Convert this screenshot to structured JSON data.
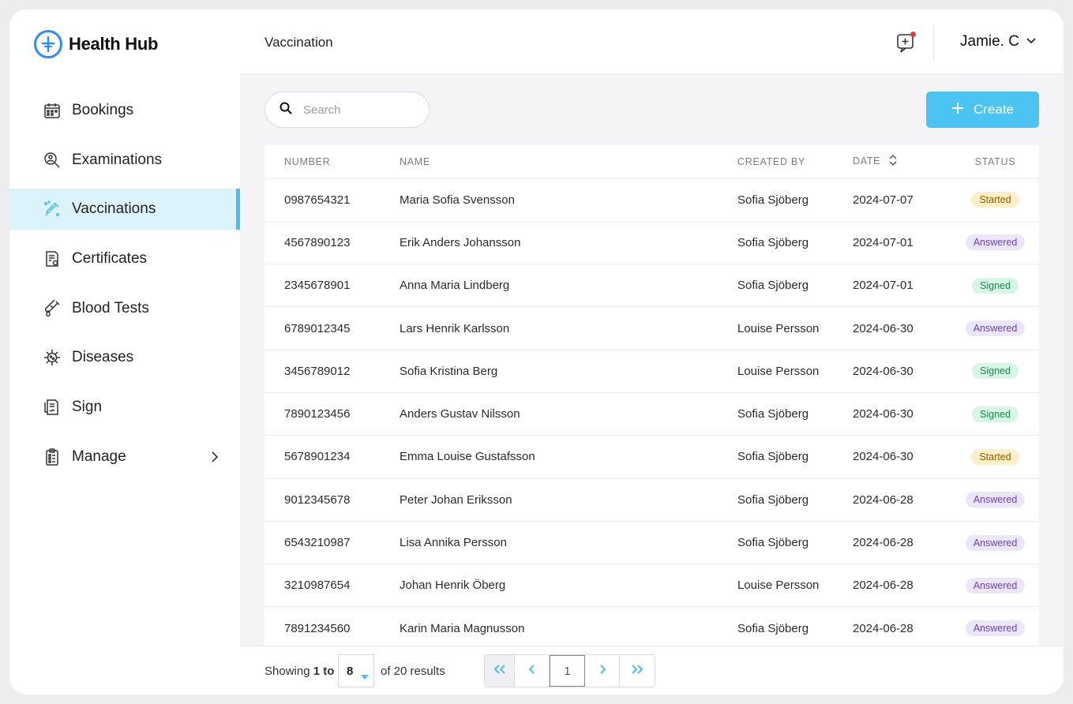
{
  "brand": {
    "name": "Health Hub",
    "icon": "health-hub-logo",
    "accent": "#2a8df5"
  },
  "sidebar": {
    "items": [
      {
        "label": "Bookings",
        "icon": "calendar-icon",
        "active": false
      },
      {
        "label": "Examinations",
        "icon": "examination-icon",
        "active": false
      },
      {
        "label": "Vaccinations",
        "icon": "syringe-icon",
        "active": true
      },
      {
        "label": "Certificates",
        "icon": "certificate-icon",
        "active": false
      },
      {
        "label": "Blood Tests",
        "icon": "blood-test-icon",
        "active": false
      },
      {
        "label": "Diseases",
        "icon": "virus-icon",
        "active": false
      },
      {
        "label": "Sign",
        "icon": "sign-icon",
        "active": false
      },
      {
        "label": "Manage",
        "icon": "clipboard-icon",
        "active": false,
        "has_submenu": true
      }
    ]
  },
  "header": {
    "title": "Vaccination",
    "notification_icon": "medical-chat-icon",
    "user_name": "Jamie. C"
  },
  "toolbar": {
    "search_placeholder": "Search",
    "create_label": "Create",
    "accent": "#4cc4f2"
  },
  "table": {
    "columns": [
      "NUMBER",
      "NAME",
      "CREATED BY",
      "DATE",
      "STATUS"
    ],
    "rows": [
      {
        "number": "0987654321",
        "name": "Maria Sofia Svensson",
        "created_by": "Sofia Sjöberg",
        "date": "2024-07-07",
        "status": "Started"
      },
      {
        "number": "4567890123",
        "name": "Erik Anders Johansson",
        "created_by": "Sofia Sjöberg",
        "date": "2024-07-01",
        "status": "Answered"
      },
      {
        "number": "2345678901",
        "name": "Anna Maria Lindberg",
        "created_by": "Sofia Sjöberg",
        "date": "2024-07-01",
        "status": "Signed"
      },
      {
        "number": "6789012345",
        "name": "Lars Henrik Karlsson",
        "created_by": "Louise Persson",
        "date": "2024-06-30",
        "status": "Answered"
      },
      {
        "number": "3456789012",
        "name": "Sofia Kristina Berg",
        "created_by": "Louise Persson",
        "date": "2024-06-30",
        "status": "Signed"
      },
      {
        "number": "7890123456",
        "name": "Anders Gustav Nilsson",
        "created_by": "Sofia Sjöberg",
        "date": "2024-06-30",
        "status": "Signed"
      },
      {
        "number": "5678901234",
        "name": "Emma Louise Gustafsson",
        "created_by": "Sofia Sjöberg",
        "date": "2024-06-30",
        "status": "Started"
      },
      {
        "number": "9012345678",
        "name": "Peter Johan Eriksson",
        "created_by": "Sofia Sjöberg",
        "date": "2024-06-28",
        "status": "Answered"
      },
      {
        "number": "6543210987",
        "name": "Lisa Annika Persson",
        "created_by": "Sofia Sjöberg",
        "date": "2024-06-28",
        "status": "Answered"
      },
      {
        "number": "3210987654",
        "name": "Johan Henrik Öberg",
        "created_by": "Louise Persson",
        "date": "2024-06-28",
        "status": "Answered"
      },
      {
        "number": "7891234560",
        "name": "Karin Maria Magnusson",
        "created_by": "Sofia Sjöberg",
        "date": "2024-06-28",
        "status": "Answered"
      }
    ],
    "status_colors": {
      "Started": "#fdefc8",
      "Answered": "#ece6fb",
      "Signed": "#d7f6e6"
    }
  },
  "footer": {
    "showing_prefix": "Showing",
    "showing_range": "1 to",
    "per_page": "8",
    "results_text": "of 20 results",
    "current_page": "1"
  }
}
